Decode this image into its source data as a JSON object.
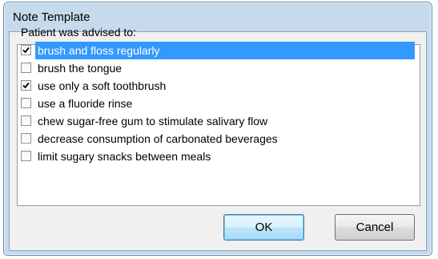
{
  "window": {
    "title": "Note Template"
  },
  "prompt": "Patient was advised to:",
  "items": [
    {
      "label": "brush and floss regularly",
      "checked": true,
      "selected": true
    },
    {
      "label": "brush the tongue",
      "checked": false,
      "selected": false
    },
    {
      "label": "use only a soft toothbrush",
      "checked": true,
      "selected": false
    },
    {
      "label": "use a fluoride rinse",
      "checked": false,
      "selected": false
    },
    {
      "label": "chew sugar-free gum to stimulate salivary flow",
      "checked": false,
      "selected": false
    },
    {
      "label": "decrease consumption of carbonated beverages",
      "checked": false,
      "selected": false
    },
    {
      "label": "limit sugary snacks between meals",
      "checked": false,
      "selected": false
    }
  ],
  "buttons": {
    "ok_label": "OK",
    "cancel_label": "Cancel"
  },
  "colors": {
    "selection": "#3399ff",
    "title_bar": "#c7daed",
    "dialog_body": "#f0f0f0"
  }
}
